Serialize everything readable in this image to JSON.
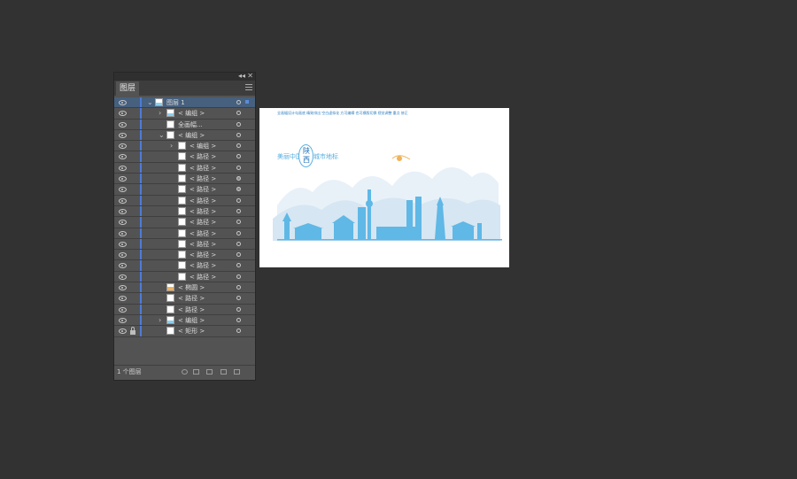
{
  "panel": {
    "tab_label": "图层",
    "collapse_symbol": "◂◂",
    "close_symbol": "✕",
    "footer_text": "1 个图层",
    "rows": [
      {
        "indent": 0,
        "chevron": "⌄",
        "thumb": "skyline",
        "label": "图层 1",
        "selected": true,
        "lock": false,
        "target": "outline"
      },
      {
        "indent": 1,
        "chevron": "›",
        "thumb": "skyline",
        "label": "< 编组 >",
        "selected": false,
        "lock": false,
        "target": "outline"
      },
      {
        "indent": 1,
        "chevron": "",
        "thumb": "white",
        "label": "全画幅...",
        "selected": false,
        "lock": false,
        "target": "outline"
      },
      {
        "indent": 1,
        "chevron": "⌄",
        "thumb": "white",
        "label": "< 编组 >",
        "selected": false,
        "lock": false,
        "target": "outline"
      },
      {
        "indent": 2,
        "chevron": "›",
        "thumb": "white",
        "label": "< 编组 >",
        "selected": false,
        "lock": false,
        "target": "outline"
      },
      {
        "indent": 2,
        "chevron": "",
        "thumb": "white",
        "label": "< 路径 >",
        "selected": false,
        "lock": false,
        "target": "outline"
      },
      {
        "indent": 2,
        "chevron": "",
        "thumb": "white",
        "label": "< 路径 >",
        "selected": false,
        "lock": false,
        "target": "outline"
      },
      {
        "indent": 2,
        "chevron": "",
        "thumb": "white",
        "label": "< 路径 >",
        "selected": false,
        "lock": false,
        "target": "filled"
      },
      {
        "indent": 2,
        "chevron": "",
        "thumb": "white",
        "label": "< 路径 >",
        "selected": false,
        "lock": false,
        "target": "filled"
      },
      {
        "indent": 2,
        "chevron": "",
        "thumb": "white",
        "label": "< 路径 >",
        "selected": false,
        "lock": false,
        "target": "outline"
      },
      {
        "indent": 2,
        "chevron": "",
        "thumb": "white",
        "label": "< 路径 >",
        "selected": false,
        "lock": false,
        "target": "outline"
      },
      {
        "indent": 2,
        "chevron": "",
        "thumb": "white",
        "label": "< 路径 >",
        "selected": false,
        "lock": false,
        "target": "outline"
      },
      {
        "indent": 2,
        "chevron": "",
        "thumb": "white",
        "label": "< 路径 >",
        "selected": false,
        "lock": false,
        "target": "outline"
      },
      {
        "indent": 2,
        "chevron": "",
        "thumb": "white",
        "label": "< 路径 >",
        "selected": false,
        "lock": false,
        "target": "outline"
      },
      {
        "indent": 2,
        "chevron": "",
        "thumb": "white",
        "label": "< 路径 >",
        "selected": false,
        "lock": false,
        "target": "outline"
      },
      {
        "indent": 2,
        "chevron": "",
        "thumb": "white",
        "label": "< 路径 >",
        "selected": false,
        "lock": false,
        "target": "outline"
      },
      {
        "indent": 2,
        "chevron": "",
        "thumb": "white",
        "label": "< 路径 >",
        "selected": false,
        "lock": false,
        "target": "outline"
      },
      {
        "indent": 1,
        "chevron": "",
        "thumb": "orange",
        "label": "< 椭圆 >",
        "selected": false,
        "lock": false,
        "target": "outline"
      },
      {
        "indent": 1,
        "chevron": "",
        "thumb": "white",
        "label": "< 路径 >",
        "selected": false,
        "lock": false,
        "target": "outline"
      },
      {
        "indent": 1,
        "chevron": "",
        "thumb": "white",
        "label": "< 路径 >",
        "selected": false,
        "lock": false,
        "target": "outline"
      },
      {
        "indent": 1,
        "chevron": "›",
        "thumb": "skyline",
        "label": "< 编组 >",
        "selected": false,
        "lock": false,
        "target": "outline"
      },
      {
        "indent": 1,
        "chevron": "",
        "thumb": "white",
        "label": "< 矩形 >",
        "selected": false,
        "lock": true,
        "target": "outline"
      }
    ],
    "footer_icons": [
      "search-icon",
      "make-clipping-mask-icon",
      "new-sublayer-icon",
      "new-layer-icon",
      "delete-icon"
    ]
  },
  "artboard": {
    "tagline": "全画幅设计勾画底 精致排出 空白虚拟化 方可编辑 也可横版切换 视觉调整 重点 修正",
    "slogan_left": "美丽中国",
    "slogan_right": "城市地标",
    "seal_text": "陕西",
    "colors": {
      "sky_blue": "#58aee0",
      "deep_blue": "#1f6fb3",
      "mist": "#dbe9f3",
      "sun": "#f0b25a"
    }
  }
}
